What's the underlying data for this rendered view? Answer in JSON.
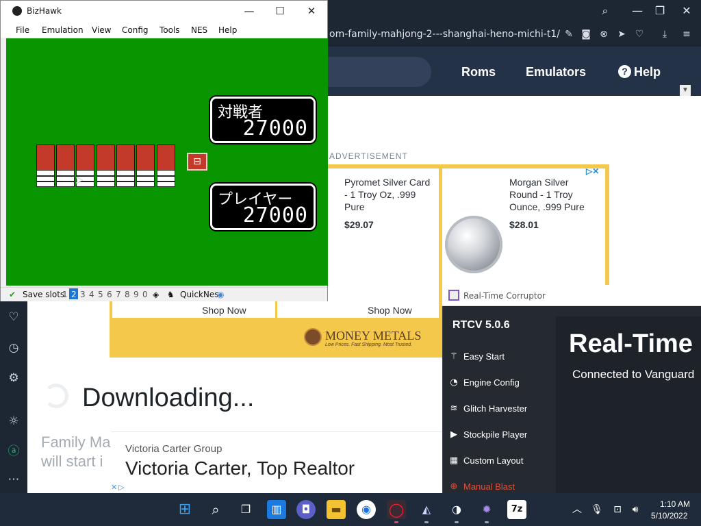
{
  "browser": {
    "url": "om-family-mahjong-2---shanghai-heno-michi-t1/",
    "nav": {
      "roms": "Roms",
      "emulators": "Emulators",
      "help": "Help"
    },
    "ad_label": "ADVERTISEMENT",
    "products": [
      {
        "title_lines": [
          "Pyromet Silver Card",
          "- 1 Troy Oz, .999",
          "Pure"
        ],
        "price": "$29.07",
        "cta": "Shop Now"
      },
      {
        "title_lines": [
          "Morgan Silver",
          "Round - 1 Troy",
          "Ounce, .999 Pure"
        ],
        "price": "$28.01",
        "cta": "Shop Now"
      }
    ],
    "first_cta": "Shop Now",
    "sponsor": {
      "name": "MONEY METALS",
      "tagline": "Low Prices. Fast Shipping. Most Trusted."
    },
    "downloading": "Downloading...",
    "download_sub": [
      "Family Ma",
      "will start i"
    ],
    "ad2": {
      "org": "Victoria Carter Group",
      "headline": "Victoria Carter, Top Realtor"
    }
  },
  "bizhawk": {
    "title": "BizHawk",
    "menu": [
      "File",
      "Emulation",
      "View",
      "Config",
      "Tools",
      "NES",
      "Help"
    ],
    "opponent": {
      "label": "対戦者",
      "score": "27000"
    },
    "player": {
      "label": "プレイヤー",
      "score": "27000"
    },
    "status": {
      "save_slots_label": "Save slots",
      "slots": [
        "1",
        "2",
        "3",
        "4",
        "5",
        "6",
        "7",
        "8",
        "9",
        "0"
      ],
      "active_slot": "2",
      "core": "QuickNes"
    }
  },
  "rtcv": {
    "window_title": "Real-Time Corruptor",
    "version": "RTCV 5.0.6",
    "menu": [
      "Easy Start",
      "Engine Config",
      "Glitch Harvester",
      "Stockpile Player",
      "Custom Layout",
      "Manual Blast"
    ],
    "heading": "Real-Time C",
    "status": "Connected to Vanguard"
  },
  "taskbar": {
    "time": "1:10 AM",
    "date": "5/10/2022"
  },
  "colors": {
    "felt_green": "#089500",
    "tile_red": "#c43a2a",
    "browser_dark": "#1d2633",
    "site_nav": "#243247",
    "ad_gold": "#f4c84a",
    "manual_blast": "#e0503a"
  }
}
